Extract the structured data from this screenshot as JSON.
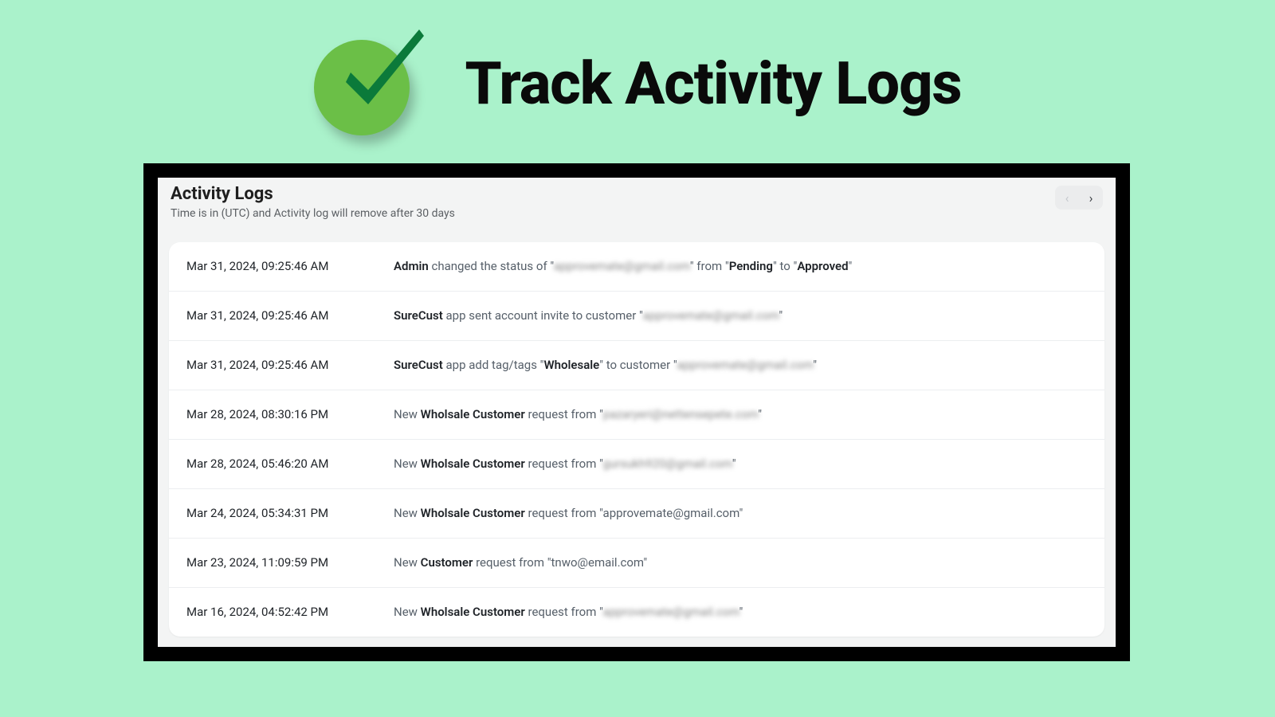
{
  "hero": {
    "title": "Track Activity Logs"
  },
  "panel": {
    "title": "Activity Logs",
    "subtitle": "Time is in (UTC) and Activity log will remove after 30 days"
  },
  "pager": {
    "prev_glyph": "‹",
    "next_glyph": "›"
  },
  "logs": [
    {
      "time": "Mar 31, 2024, 09:25:46 AM",
      "type": "status_change",
      "actor": "Admin",
      "text1": " changed the status of \"",
      "email": "approvemate@gmail.com",
      "email_blur": true,
      "text2": "\" from \"",
      "bold2": "Pending",
      "text3": "\" to \"",
      "bold3": "Approved",
      "text4": "\""
    },
    {
      "time": "Mar 31, 2024, 09:25:46 AM",
      "type": "invite",
      "actor": "SureCust",
      "text1": " app sent account invite to customer \"",
      "email": "approvemate@gmail.com",
      "email_blur": true,
      "text2": "\""
    },
    {
      "time": "Mar 31, 2024, 09:25:46 AM",
      "type": "tag",
      "actor": "SureCust",
      "text1": " app add tag/tags \"",
      "bold1": "Wholesale",
      "text2": "\" to customer \"",
      "email": "approvemate@gmail.com",
      "email_blur": true,
      "text3": "\""
    },
    {
      "time": "Mar 28, 2024, 08:30:16 PM",
      "type": "request",
      "text0": "New ",
      "actor": "Wholsale Customer",
      "text1": " request from \"",
      "email": "pazaryeri@nettensepete.com",
      "email_blur": true,
      "text2": "\""
    },
    {
      "time": "Mar 28, 2024, 05:46:20 AM",
      "type": "request",
      "text0": "New ",
      "actor": "Wholsale Customer",
      "text1": " request from \"",
      "email": "gursukh920@gmail.com",
      "email_blur": true,
      "text2": "\""
    },
    {
      "time": "Mar 24, 2024, 05:34:31 PM",
      "type": "request",
      "text0": "New ",
      "actor": "Wholsale Customer",
      "text1": " request from \"",
      "email": "approvemate@gmail.com",
      "email_blur": false,
      "text2": "\""
    },
    {
      "time": "Mar 23, 2024, 11:09:59 PM",
      "type": "request",
      "text0": "New ",
      "actor": "Customer",
      "text1": " request from \"",
      "email": "tnwo@email.com",
      "email_blur": false,
      "text2": "\""
    },
    {
      "time": "Mar 16, 2024, 04:52:42 PM",
      "type": "request",
      "text0": "New ",
      "actor": "Wholsale Customer",
      "text1": " request from \"",
      "email": "approvemate@gmail.com",
      "email_blur": true,
      "text2": "\""
    }
  ]
}
